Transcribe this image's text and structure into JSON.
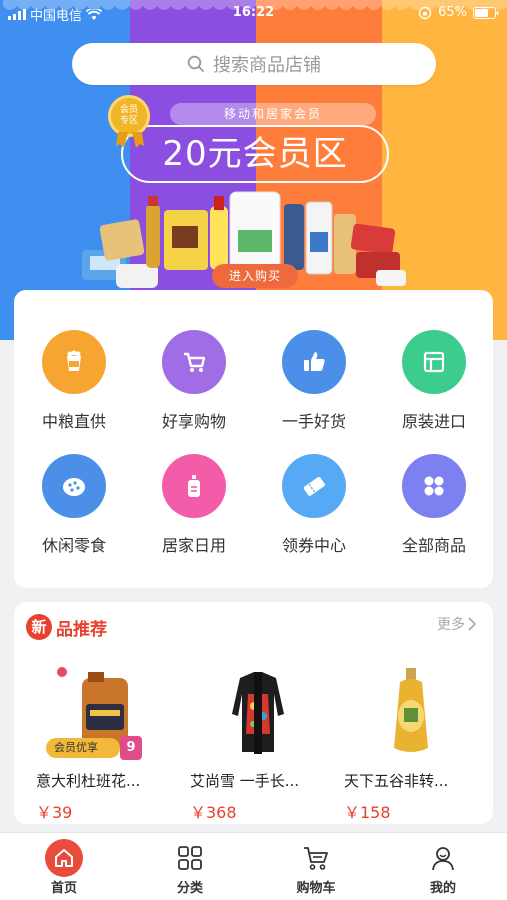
{
  "status_bar": {
    "carrier": "中国电信",
    "time": "16:22",
    "battery": "65%"
  },
  "search": {
    "placeholder": "搜索商品店铺"
  },
  "banner": {
    "badge": "会员专区",
    "subtitle": "移动和居家会员",
    "title": "20元会员区",
    "button": "进入购买"
  },
  "categories": [
    {
      "label": "中粮直供",
      "icon": "box-icon",
      "color": "#f7a531"
    },
    {
      "label": "好享购物",
      "icon": "cart-icon",
      "color": "#a06de6"
    },
    {
      "label": "一手好货",
      "icon": "thumb-up-icon",
      "color": "#4b8fe8"
    },
    {
      "label": "原装进口",
      "icon": "import-icon",
      "color": "#3ccc8e"
    },
    {
      "label": "休闲零食",
      "icon": "cookie-icon",
      "color": "#4b8fe8"
    },
    {
      "label": "居家日用",
      "icon": "bottle-icon",
      "color": "#f35ca8"
    },
    {
      "label": "领券中心",
      "icon": "coupon-icon",
      "color": "#56a9f5"
    },
    {
      "label": "全部商品",
      "icon": "grid-icon",
      "color": "#7d80f0"
    }
  ],
  "new_products": {
    "badge": "新",
    "title": "品推荐",
    "more": "更多",
    "items": [
      {
        "name": "意大利杜班花...",
        "price": "￥39",
        "tag": "会员优享",
        "tag_num": "9"
      },
      {
        "name": "艾尚雪 一手长...",
        "price": "￥368"
      },
      {
        "name": "天下五谷非转...",
        "price": "￥158"
      }
    ]
  },
  "tabbar": [
    {
      "label": "首页",
      "icon": "home-icon",
      "active": true
    },
    {
      "label": "分类",
      "icon": "category-grid-icon"
    },
    {
      "label": "购物车",
      "icon": "cart-icon"
    },
    {
      "label": "我的",
      "icon": "user-icon"
    }
  ]
}
